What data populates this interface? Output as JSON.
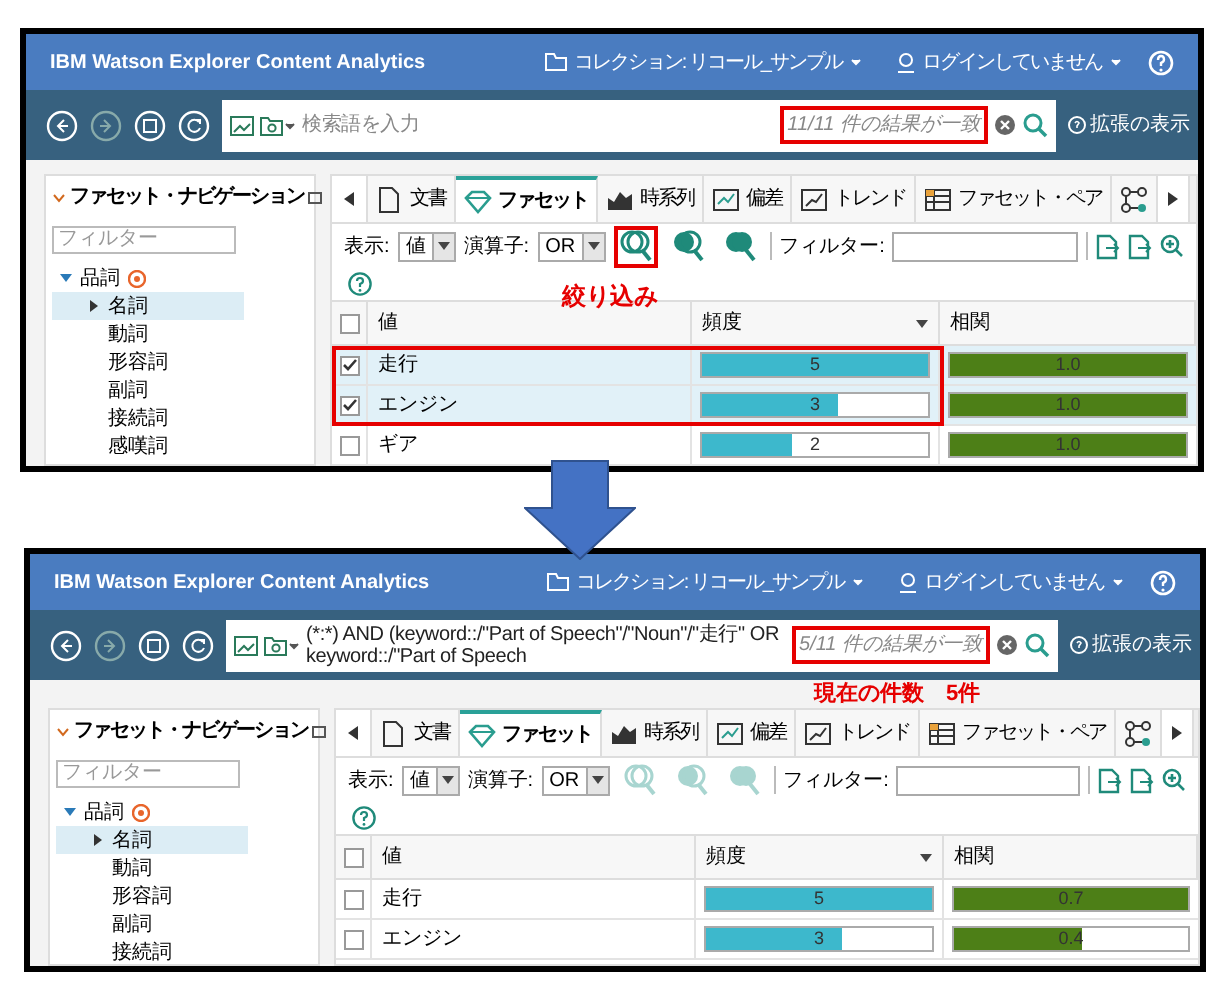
{
  "panels": [
    {
      "header": {
        "title": "IBM Watson Explorer Content Analytics",
        "collection": "コレクション: リコール_サンプル",
        "login": "ログインしていません"
      },
      "search": {
        "placeholder": "検索語を入力",
        "result_count": "11/11 件の結果が一致",
        "result_highlighted": true,
        "advanced": "拡張の表示"
      },
      "sidebar": {
        "title": "ファセット・ナビゲーション",
        "filter_placeholder": "フィルター",
        "tree": [
          {
            "label": "品詞",
            "expanded": true,
            "children": [
              {
                "label": "名詞",
                "selected": true,
                "expanded": false
              },
              {
                "label": "動詞",
                "selected": false
              },
              {
                "label": "形容詞",
                "selected": false
              },
              {
                "label": "副詞",
                "selected": false
              },
              {
                "label": "接続詞",
                "selected": false
              },
              {
                "label": "感嘆詞",
                "selected": false
              }
            ]
          }
        ]
      },
      "tabs": [
        {
          "kind": "document",
          "label": "文書",
          "selected": false
        },
        {
          "kind": "facet",
          "label": "ファセット",
          "selected": true
        },
        {
          "kind": "timeseries",
          "label": "時系列",
          "selected": false
        },
        {
          "kind": "deviation",
          "label": "偏差",
          "selected": false
        },
        {
          "kind": "trend",
          "label": "トレンド",
          "selected": false
        },
        {
          "kind": "pair",
          "label": "ファセット・ペア",
          "selected": false
        },
        {
          "kind": "connections",
          "selected": false
        }
      ],
      "toolbar": {
        "display_label": "表示:",
        "display_value": "値",
        "operator_label": "演算子:",
        "operator_value": "OR",
        "filter_label": "フィルター:",
        "search_actions_disabled": false,
        "refine_highlighted": true
      },
      "annotation": {
        "text": "絞り込み",
        "kind": "refine"
      },
      "table": {
        "columns": [
          "値",
          "頻度",
          "相関"
        ],
        "select_all_checked": false,
        "rows_highlighted": true,
        "rows": [
          {
            "value": "走行",
            "checked": true,
            "frequency": {
              "text": "5",
              "level": 1.0
            },
            "correlation": {
              "text": "1.0",
              "level": 1.0
            }
          },
          {
            "value": "エンジン",
            "checked": true,
            "frequency": {
              "text": "3",
              "level": 0.6
            },
            "correlation": {
              "text": "1.0",
              "level": 1.0
            }
          },
          {
            "value": "ギア",
            "checked": false,
            "frequency": {
              "text": "2",
              "level": 0.4
            },
            "correlation": {
              "text": "1.0",
              "level": 1.0
            }
          }
        ]
      }
    },
    {
      "header": {
        "title": "IBM Watson Explorer Content Analytics",
        "collection": "コレクション: リコール_サンプル",
        "login": "ログインしていません"
      },
      "search": {
        "value": "(*:*) AND (keyword::/\"Part of Speech\"/\"Noun\"/\"走行\" OR keyword::/\"Part of Speech",
        "result_count": "5/11 件の結果が一致",
        "result_highlighted": true,
        "advanced": "拡張の表示"
      },
      "sidebar": {
        "title": "ファセット・ナビゲーション",
        "filter_placeholder": "フィルター",
        "tree": [
          {
            "label": "品詞",
            "expanded": true,
            "children": [
              {
                "label": "名詞",
                "selected": true,
                "expanded": false
              },
              {
                "label": "動詞",
                "selected": false
              },
              {
                "label": "形容詞",
                "selected": false
              },
              {
                "label": "副詞",
                "selected": false
              },
              {
                "label": "接続詞",
                "selected": false
              }
            ]
          }
        ]
      },
      "tabs": [
        {
          "kind": "document",
          "label": "文書",
          "selected": false
        },
        {
          "kind": "facet",
          "label": "ファセット",
          "selected": true
        },
        {
          "kind": "timeseries",
          "label": "時系列",
          "selected": false
        },
        {
          "kind": "deviation",
          "label": "偏差",
          "selected": false
        },
        {
          "kind": "trend",
          "label": "トレンド",
          "selected": false
        },
        {
          "kind": "pair",
          "label": "ファセット・ペア",
          "selected": false
        },
        {
          "kind": "connections",
          "selected": false
        }
      ],
      "toolbar": {
        "display_label": "表示:",
        "display_value": "値",
        "operator_label": "演算子:",
        "operator_value": "OR",
        "filter_label": "フィルター:",
        "search_actions_disabled": true,
        "refine_highlighted": false
      },
      "annotation": {
        "text": "現在の件数　5件",
        "kind": "count"
      },
      "table": {
        "columns": [
          "値",
          "頻度",
          "相関"
        ],
        "select_all_checked": false,
        "rows_highlighted": false,
        "rows": [
          {
            "value": "走行",
            "checked": false,
            "frequency": {
              "text": "5",
              "level": 1.0
            },
            "correlation": {
              "text": "0.7",
              "level": 1.0
            }
          },
          {
            "value": "エンジン",
            "checked": false,
            "frequency": {
              "text": "3",
              "level": 0.6
            },
            "correlation": {
              "text": "0.4",
              "level": 0.55
            }
          }
        ]
      }
    }
  ]
}
